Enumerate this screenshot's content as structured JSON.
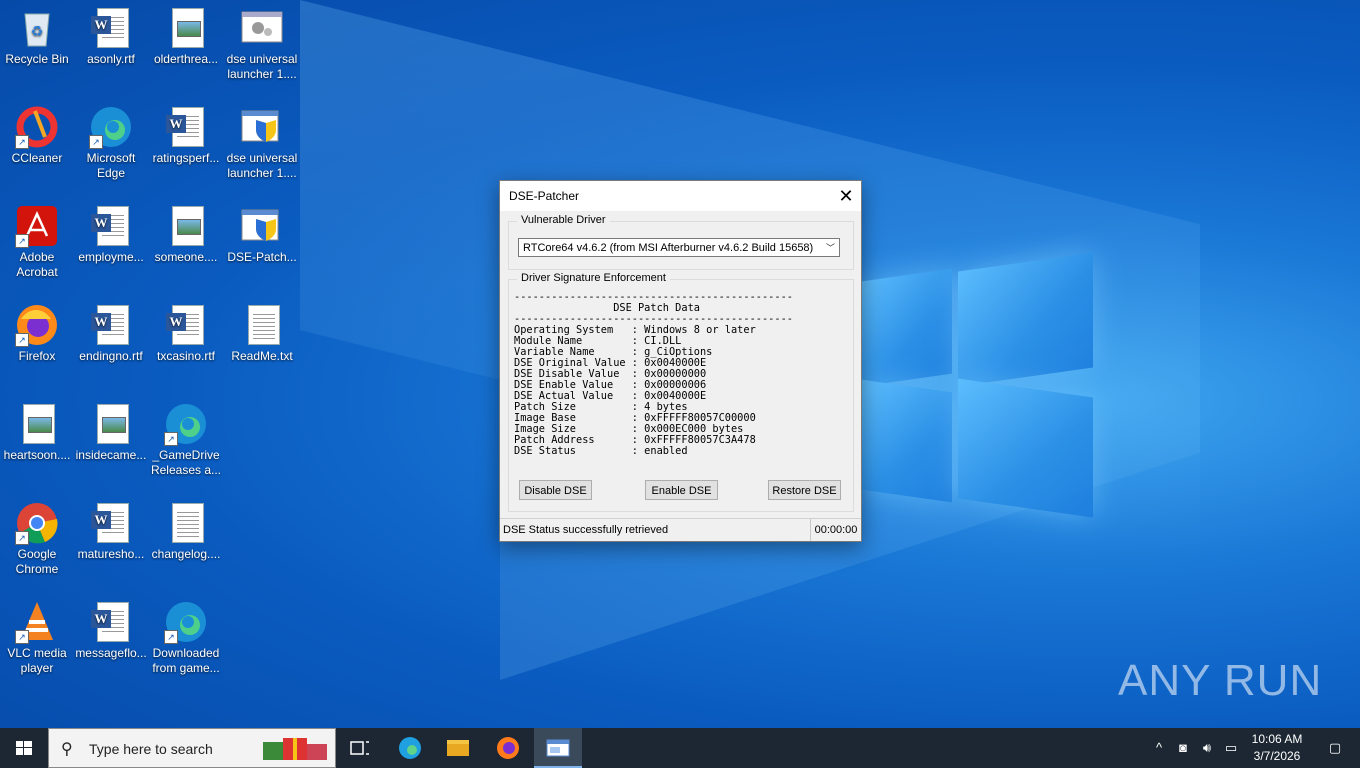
{
  "desktop": {
    "icons": [
      {
        "label": "Recycle Bin",
        "icon": "recycle-bin-icon"
      },
      {
        "label": "asonly.rtf",
        "icon": "word-doc-icon"
      },
      {
        "label": "olderthrea...",
        "icon": "image-doc-icon"
      },
      {
        "label": "dse universal launcher 1....",
        "icon": "app-gears-icon"
      },
      {
        "label": "CCleaner",
        "icon": "ccleaner-icon"
      },
      {
        "label": "Microsoft Edge",
        "icon": "edge-icon"
      },
      {
        "label": "ratingsperf...",
        "icon": "word-doc-icon"
      },
      {
        "label": "dse universal launcher 1....",
        "icon": "shield-app-icon"
      },
      {
        "label": "Adobe Acrobat",
        "icon": "acrobat-icon"
      },
      {
        "label": "employme...",
        "icon": "word-doc-icon"
      },
      {
        "label": "someone....",
        "icon": "image-doc-icon"
      },
      {
        "label": "DSE-Patch...",
        "icon": "shield-app-icon"
      },
      {
        "label": "Firefox",
        "icon": "firefox-icon"
      },
      {
        "label": "endingno.rtf",
        "icon": "word-doc-icon"
      },
      {
        "label": "txcasino.rtf",
        "icon": "word-doc-icon"
      },
      {
        "label": "ReadMe.txt",
        "icon": "text-doc-icon"
      },
      {
        "label": "heartsoon....",
        "icon": "image-doc-icon"
      },
      {
        "label": "insidecame...",
        "icon": "image-doc-icon"
      },
      {
        "label": "_GameDrive Releases a...",
        "icon": "edge-icon"
      },
      {
        "label": "Google Chrome",
        "icon": "chrome-icon"
      },
      {
        "label": "maturesho...",
        "icon": "word-doc-icon"
      },
      {
        "label": "changelog....",
        "icon": "text-doc-icon"
      },
      {
        "label": "VLC media player",
        "icon": "vlc-icon"
      },
      {
        "label": "messageflo...",
        "icon": "word-doc-icon"
      },
      {
        "label": "Downloaded from game...",
        "icon": "edge-icon"
      }
    ]
  },
  "dialog": {
    "title": "DSE-Patcher",
    "driver_group": "Vulnerable Driver",
    "driver_selected": "RTCore64 v4.6.2 (from MSI Afterburner v4.6.2 Build 15658)",
    "dse_group": "Driver Signature Enforcement",
    "patch_lines": [
      "---------------------------------------------",
      "                DSE Patch Data",
      "---------------------------------------------",
      "Operating System   : Windows 8 or later",
      "Module Name        : CI.DLL",
      "Variable Name      : g_CiOptions",
      "DSE Original Value : 0x0040000E",
      "DSE Disable Value  : 0x00000000",
      "DSE Enable Value   : 0x00000006",
      "DSE Actual Value   : 0x0040000E",
      "Patch Size         : 4 bytes",
      "Image Base         : 0xFFFFF80057C00000",
      "Image Size         : 0x000EC000 bytes",
      "Patch Address      : 0xFFFFF80057C3A478",
      "DSE Status         : enabled"
    ],
    "buttons": {
      "disable": "Disable DSE",
      "enable": "Enable DSE",
      "restore": "Restore DSE"
    },
    "status_text": "DSE Status successfully retrieved",
    "status_time": "00:00:00"
  },
  "taskbar": {
    "search_placeholder": "Type here to search",
    "clock_time": "10:06 AM",
    "clock_date": "3/7/2026"
  },
  "watermark": "ANY RUN"
}
